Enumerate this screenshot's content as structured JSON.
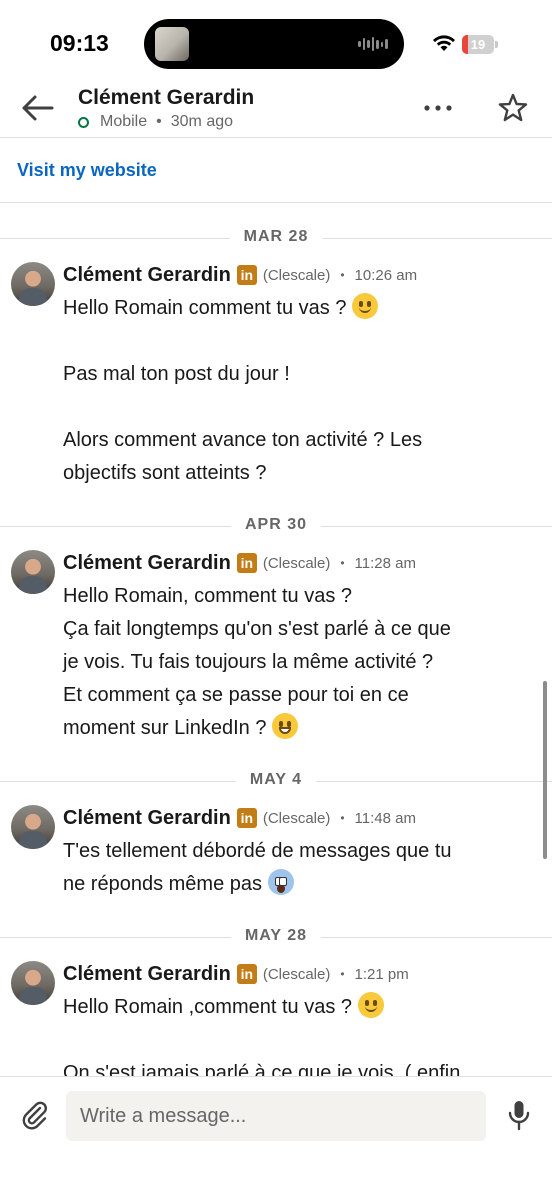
{
  "status_bar": {
    "time": "09:13",
    "battery_level": "19",
    "battery_color": "#e8463a"
  },
  "header": {
    "contact_name": "Clément Gerardin",
    "presence_status": "Mobile",
    "separator": "•",
    "last_seen": "30m ago",
    "back_icon": "arrow-left-icon",
    "more_icon": "more-horizontal-icon",
    "star_icon": "star-outline-icon"
  },
  "profile_link": {
    "label": "Visit my website",
    "color": "#0a66c2"
  },
  "conversation": [
    {
      "date": "MAR 28",
      "sender": "Clément Gerardin",
      "badge": "in",
      "company": "(Clescale)",
      "dot": "•",
      "time": "10:26 am",
      "lines": [
        "Hello Romain comment tu vas ?",
        "",
        "Pas mal ton post du jour !",
        "",
        "Alors comment avance ton activité ? Les",
        "objectifs sont atteints ?"
      ]
    },
    {
      "date": "APR 30",
      "sender": "Clément Gerardin",
      "badge": "in",
      "company": "(Clescale)",
      "dot": "•",
      "time": "11:28 am",
      "lines": [
        "Hello Romain, comment tu vas ?",
        "Ça fait longtemps qu'on s'est parlé à ce que",
        "je vois. Tu fais toujours la même activité ?",
        "Et comment ça se passe pour toi en ce",
        "moment sur LinkedIn ?"
      ]
    },
    {
      "date": "MAY 4",
      "sender": "Clément Gerardin",
      "badge": "in",
      "company": "(Clescale)",
      "dot": "•",
      "time": "11:48 am",
      "lines": [
        "T'es tellement débordé de messages que tu",
        "ne réponds même pas"
      ]
    },
    {
      "date": "MAY 28",
      "sender": "Clément Gerardin",
      "badge": "in",
      "company": "(Clescale)",
      "dot": "•",
      "time": "1:21 pm",
      "lines": [
        "Hello Romain ,comment tu vas ?",
        "",
        "On s'est jamais parlé à ce que je vois. ( enfin"
      ]
    }
  ],
  "composer": {
    "placeholder": "Write a message...",
    "attach_icon": "paperclip-icon",
    "mic_icon": "microphone-icon"
  }
}
